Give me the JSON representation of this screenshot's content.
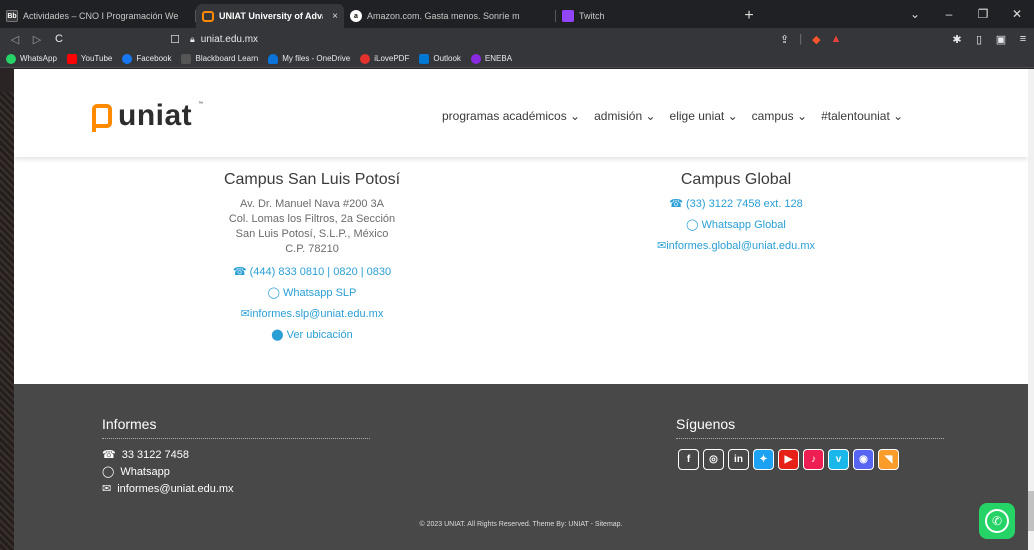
{
  "browser": {
    "tabs": [
      {
        "title": "Actividades – CNO I Programación We",
        "favicon": "blackboard-icon",
        "active": false
      },
      {
        "title": "UNIAT University of Advanced Te",
        "favicon": "uniat-icon",
        "active": true,
        "close": "×"
      },
      {
        "title": "Amazon.com. Gasta menos. Sonríe m",
        "favicon": "amazon-icon",
        "active": false
      },
      {
        "title": "Twitch",
        "favicon": "twitch-icon",
        "active": false
      }
    ],
    "new_tab": "+",
    "window_controls": {
      "dropdown": "⌄",
      "minimize": "–",
      "restore": "❐",
      "close": "✕"
    },
    "nav": {
      "back": "◁",
      "forward": "▷",
      "reload": "C",
      "bookmark": "☐"
    },
    "url": "uniat.edu.mx",
    "bookmarks": [
      {
        "label": "WhatsApp",
        "color": "#25d366"
      },
      {
        "label": "YouTube",
        "color": "#ff0000"
      },
      {
        "label": "Facebook",
        "color": "#1877f2"
      },
      {
        "label": "Blackboard Learn",
        "color": "#555555"
      },
      {
        "label": "My files - OneDrive",
        "color": "#0a74da"
      },
      {
        "label": "iLovePDF",
        "color": "#e5322d"
      },
      {
        "label": "Outlook",
        "color": "#0078d4"
      },
      {
        "label": "ENEBA",
        "color": "#8a2be2"
      }
    ]
  },
  "site": {
    "logo_text": "uniat",
    "logo_tm": "™",
    "nav": [
      {
        "label": "programas académicos ⌄"
      },
      {
        "label": "admisión ⌄"
      },
      {
        "label": "elige uniat ⌄"
      },
      {
        "label": "campus ⌄"
      },
      {
        "label": "#talentouniat ⌄"
      }
    ]
  },
  "campus_slp": {
    "title": "Campus San Luis Potosí",
    "address": [
      "Av. Dr. Manuel Nava #200 3A",
      "Col. Lomas los Filtros, 2a Sección",
      "San Luis Potosí, S.L.P., México",
      "C.P. 78210"
    ],
    "phone": "(444) 833 0810 | 0820 | 0830",
    "whatsapp": "Whatsapp SLP",
    "email": "informes.slp@uniat.edu.mx",
    "location": "Ver ubicación"
  },
  "campus_global": {
    "title": "Campus Global",
    "phone": "(33) 3122 7458 ext. 128",
    "whatsapp": "Whatsapp Global",
    "email": "informes.global@uniat.edu.mx"
  },
  "footer": {
    "informes_title": "Informes",
    "phone": "33 3122 7458",
    "whatsapp": "Whatsapp",
    "email": "informes@uniat.edu.mx",
    "siguenos_title": "Síguenos",
    "socials": [
      {
        "name": "facebook-icon",
        "glyph": "f",
        "bg": "transparent"
      },
      {
        "name": "instagram-icon",
        "glyph": "◎",
        "bg": "transparent"
      },
      {
        "name": "linkedin-icon",
        "glyph": "in",
        "bg": "transparent"
      },
      {
        "name": "twitter-icon",
        "glyph": "✦",
        "bg": "#1da1f2"
      },
      {
        "name": "youtube-icon",
        "glyph": "▶",
        "bg": "#e62117"
      },
      {
        "name": "tiktok-icon",
        "glyph": "♪",
        "bg": "#ee1d52"
      },
      {
        "name": "vimeo-icon",
        "glyph": "v",
        "bg": "#1ab7ea"
      },
      {
        "name": "discord-icon",
        "glyph": "◉",
        "bg": "#5865f2"
      },
      {
        "name": "rss-icon",
        "glyph": "◥",
        "bg": "#f99c2a"
      }
    ],
    "copyright": "© 2023 UNIAT. All Rights Reserved. Theme By: UNIAT - Sitemap."
  }
}
